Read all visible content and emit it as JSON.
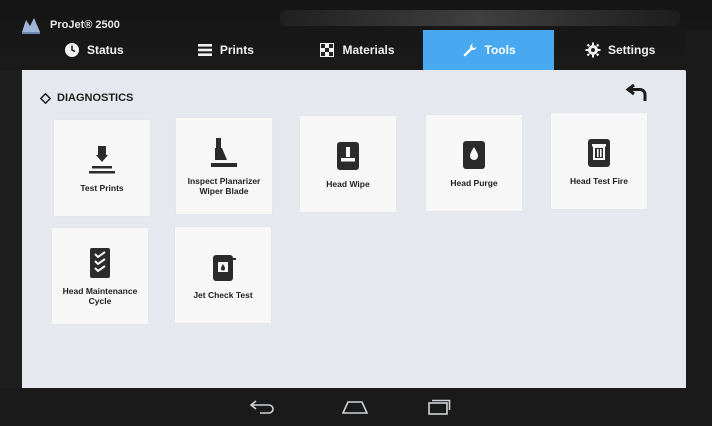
{
  "app": {
    "title": "ProJet® 2500"
  },
  "tabs": [
    {
      "label": "Status",
      "icon": "clock-icon",
      "active": false
    },
    {
      "label": "Prints",
      "icon": "list-icon",
      "active": false
    },
    {
      "label": "Materials",
      "icon": "checker-icon",
      "active": false
    },
    {
      "label": "Tools",
      "icon": "wrench-icon",
      "active": true
    },
    {
      "label": "Settings",
      "icon": "gear-icon",
      "active": false
    }
  ],
  "section": {
    "title": "DIAGNOSTICS"
  },
  "tiles": [
    {
      "label": "Test Prints",
      "icon": "test-print-icon"
    },
    {
      "label": "Inspect Planarizer Wiper Blade",
      "icon": "wiper-blade-icon"
    },
    {
      "label": "Head Wipe",
      "icon": "head-wipe-icon"
    },
    {
      "label": "Head Purge",
      "icon": "head-purge-icon"
    },
    {
      "label": "Head Test Fire",
      "icon": "head-test-fire-icon"
    },
    {
      "label": "Head Maintenance Cycle",
      "icon": "maintenance-cycle-icon"
    },
    {
      "label": "Jet Check Test",
      "icon": "jet-check-icon"
    }
  ],
  "colors": {
    "accent": "#49a9f0",
    "panel": "#e5e9ef",
    "tile": "#f7f7f7",
    "icon": "#2b2b2b"
  }
}
